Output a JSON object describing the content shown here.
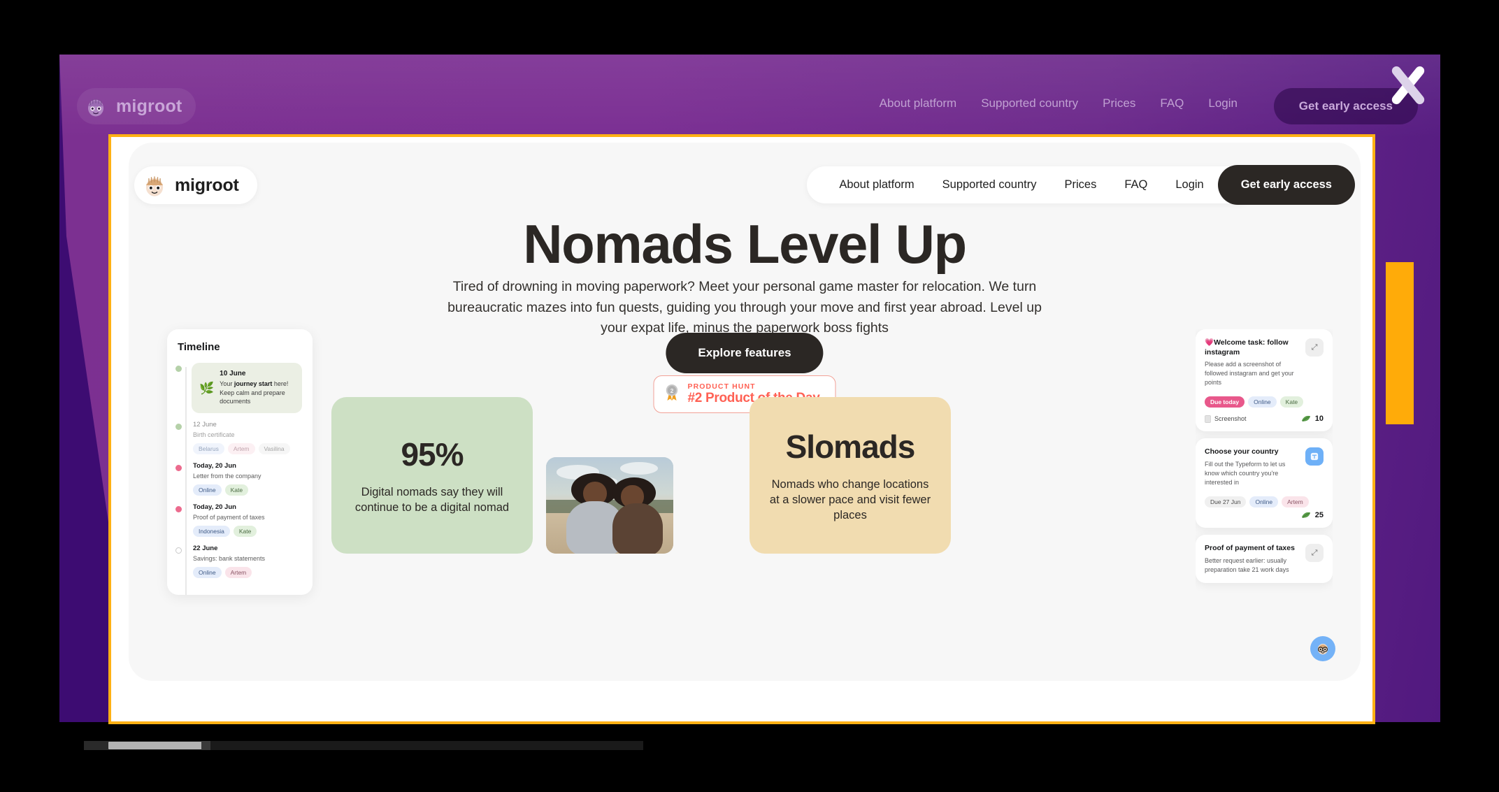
{
  "brand": {
    "name": "migroot",
    "logo_icon": "migroot-avatar-icon"
  },
  "backdrop_nav": {
    "items": [
      {
        "label": "About platform"
      },
      {
        "label": "Supported country"
      },
      {
        "label": "Prices"
      },
      {
        "label": "FAQ"
      },
      {
        "label": "Login"
      }
    ],
    "cta": "Get early access"
  },
  "modal_nav": {
    "items": [
      {
        "label": "About platform"
      },
      {
        "label": "Supported country"
      },
      {
        "label": "Prices"
      },
      {
        "label": "FAQ"
      },
      {
        "label": "Login"
      }
    ],
    "cta": "Get early access"
  },
  "hero": {
    "title": "Nomads Level Up",
    "subtitle": "Tired of drowning in moving paperwork? Meet your personal game master for relocation. We turn bureaucratic mazes into fun quests, guiding you through your move and first year abroad. Level up your expat life, minus the paperwork boss fights",
    "explore_button": "Explore features"
  },
  "product_hunt": {
    "icon": "medal-icon",
    "label": "PRODUCT HUNT",
    "title": "#2 Product of the Day"
  },
  "stats": [
    {
      "value": "95%",
      "caption": "Digital nomads say they will continue to be a digital nomad",
      "color": "#cde0c4"
    },
    {
      "value": "Slomads",
      "caption": "Nomads who change locations at a slower pace and visit fewer places",
      "color": "#f1dcb0"
    }
  ],
  "photo": {
    "alt": "Two women smiling on a beach"
  },
  "timeline": {
    "title": "Timeline",
    "hero_item": {
      "emoji": "🌿",
      "date": "10 June",
      "desc_before": "Your ",
      "desc_bold": "journey start",
      "desc_after": " here! Keep calm and prepare documents"
    },
    "items": [
      {
        "dot": "green",
        "date": "12 June",
        "desc": "Birth certificate",
        "tags": [
          {
            "label": "Belarus",
            "style": "blue"
          },
          {
            "label": "Artem",
            "style": "pink"
          },
          {
            "label": "Vasilina",
            "style": "grey"
          }
        ]
      },
      {
        "dot": "pink",
        "date": "Today, 20 Jun",
        "desc": "Letter from the company",
        "tags": [
          {
            "label": "Online",
            "style": "blue"
          },
          {
            "label": "Kate",
            "style": "green"
          }
        ]
      },
      {
        "dot": "pink",
        "date": "Today, 20 Jun",
        "desc": "Proof of payment of taxes",
        "tags": [
          {
            "label": "Indonesia",
            "style": "blue"
          },
          {
            "label": "Kate",
            "style": "green"
          }
        ]
      },
      {
        "dot": "open",
        "date": "22 June",
        "desc": "Savings: bank statements",
        "tags": [
          {
            "label": "Online",
            "style": "blue"
          },
          {
            "label": "Artem",
            "style": "pink"
          }
        ]
      }
    ]
  },
  "tasks": [
    {
      "title": "💗Welcome task: follow instagram",
      "desc": "Please add a screenshot of followed instagram and get your points",
      "button_icon": "arrow-down-right-icon",
      "button_style": "grey",
      "tags": [
        {
          "label": "Due today",
          "style": "due"
        },
        {
          "label": "Online",
          "style": "blue"
        },
        {
          "label": "Kate",
          "style": "green"
        }
      ],
      "attachment_icon": "document-icon",
      "attachment": "Screenshot",
      "points_icon": "leaf-icon",
      "points": "10"
    },
    {
      "title": "Choose your country",
      "desc": "Fill out the Typeform to let us know which country you're interested in",
      "button_icon": "typeform-icon",
      "button_style": "blue",
      "tags": [
        {
          "label": "Due 27 Jun",
          "style": "duegrey"
        },
        {
          "label": "Online",
          "style": "blue"
        },
        {
          "label": "Artem",
          "style": "pink"
        }
      ],
      "attachment_icon": "",
      "attachment": "",
      "points_icon": "leaf-icon",
      "points": "25"
    },
    {
      "title": "Proof of payment of taxes",
      "desc": "Better request earlier: usually preparation take 21 work days",
      "button_icon": "arrow-down-right-icon",
      "button_style": "grey",
      "tags": [],
      "attachment_icon": "",
      "attachment": "",
      "points_icon": "",
      "points": ""
    }
  ],
  "chat": {
    "icon": "support-avatar-icon"
  },
  "close": {
    "icon": "close-x-icon"
  },
  "colors": {
    "purple": "#7b2f93",
    "purple_dark": "#3d0c72",
    "amber": "#ffab09",
    "frame_border": "#ffb114",
    "dark": "#2b2724",
    "product_hunt": "#ff6154",
    "green_card": "#cde0c4",
    "beige_card": "#f1dcb0"
  }
}
